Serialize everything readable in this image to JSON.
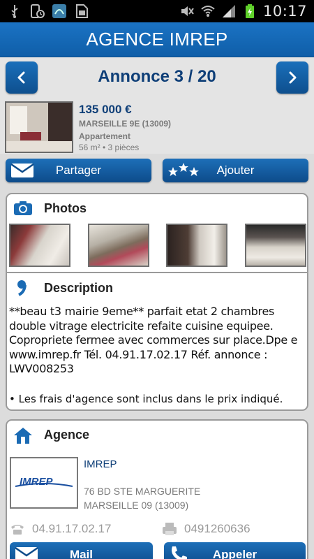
{
  "status_bar": {
    "time": "10:17",
    "battery_color": "#5fd02a"
  },
  "app": {
    "title": "AGENCE IMREP",
    "accent": "#1266b2"
  },
  "navigation": {
    "title": "Annonce 3 / 20"
  },
  "listing": {
    "price": "135 000 €",
    "city": "MARSEILLE 9E (13009)",
    "type": "Appartement",
    "surface_rooms": "56 m² • 3 pièces"
  },
  "actions": {
    "share_label": "Partager",
    "add_label": "Ajouter"
  },
  "photos": {
    "header": "Photos"
  },
  "description": {
    "header": "Description",
    "lines": [
      "**beau t3 mairie 9eme** parfait etat 2 chambres",
      "double vitrage electricite refaite cuisine equipee.",
      "Copropriete fermee avec commerces sur place.Dpe e",
      "www.imrep.fr Tél. 04.91.17.02.17 Réf. annonce :",
      "LWV008253"
    ],
    "note": "• Les frais d'agence sont inclus dans le prix indiqué."
  },
  "agency": {
    "header": "Agence",
    "logo_text": "IMREP",
    "name": "IMREP",
    "address_line1": "76 BD STE MARGUERITE",
    "address_line2": "MARSEILLE 09 (13009)",
    "phone": "04.91.17.02.17",
    "fax": "0491260636",
    "mail_label": "Mail",
    "call_label": "Appeler"
  }
}
